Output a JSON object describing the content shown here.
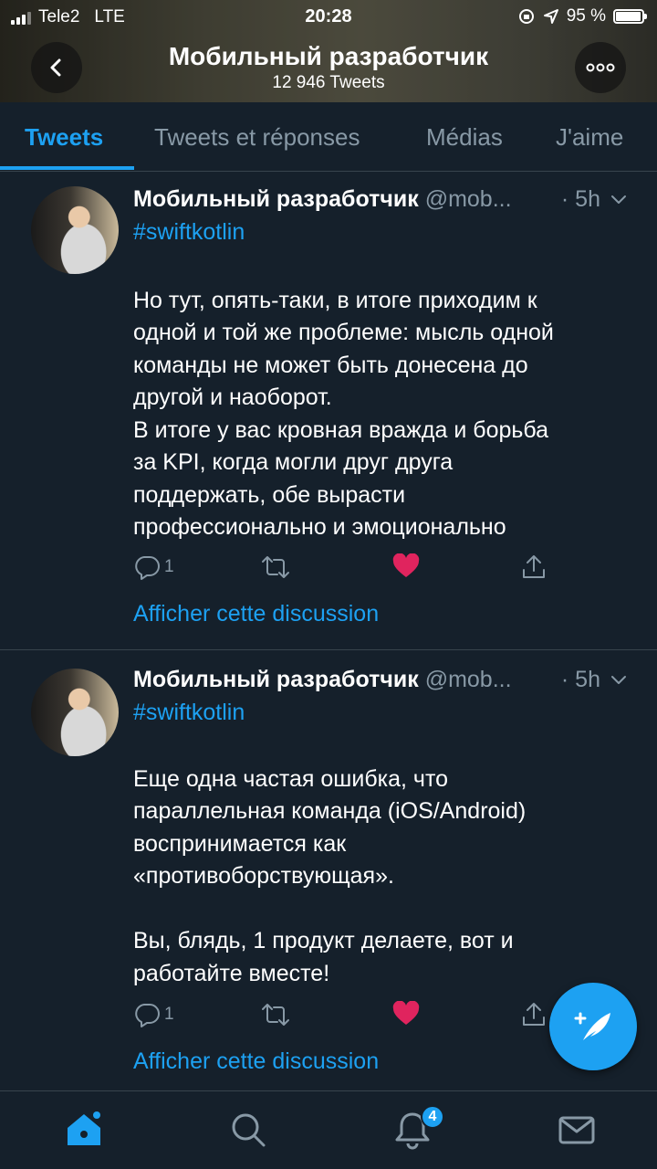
{
  "status_bar": {
    "carrier": "Tele2",
    "network": "LTE",
    "time": "20:28",
    "battery": "95 %"
  },
  "header": {
    "title": "Мобильный разработчик",
    "tweet_count": "12 946 Tweets"
  },
  "tabs": [
    {
      "label": "Tweets",
      "active": true
    },
    {
      "label": "Tweets et réponses",
      "active": false
    },
    {
      "label": "Médias",
      "active": false
    },
    {
      "label": "J'aime",
      "active": false
    }
  ],
  "tweets": [
    {
      "name": "Мобильный разработчик",
      "handle": "@mob...",
      "time": "· 5h",
      "hashtag": "#swiftkotlin",
      "lines": [
        "",
        "Но тут, опять-таки, в итоге приходим к",
        "одной и той же проблеме: мысль одной",
        "команды не может быть донесена до",
        "другой и наоборот.",
        "В итоге у вас кровная вражда и борьба",
        "за KPI, когда могли друг друга",
        "поддержать, обе вырасти",
        "профессионально и эмоционально"
      ],
      "reply_count": "1",
      "thread_link": "Afficher cette discussion"
    },
    {
      "name": "Мобильный разработчик",
      "handle": "@mob...",
      "time": "· 5h",
      "hashtag": "#swiftkotlin",
      "lines": [
        "",
        "Еще одна частая ошибка, что",
        "параллельная команда (iOS/Android)",
        "воспринимается как",
        "«противоборствующая».",
        "",
        "Вы, блядь, 1 продукт делаете, вот и",
        "работайте вместе!"
      ],
      "reply_count": "1",
      "thread_link": "Afficher cette discussion"
    }
  ],
  "bottom_nav": {
    "notifications_badge": "4"
  },
  "colors": {
    "background": "#15202b",
    "accent": "#1da1f2",
    "like": "#e0245e",
    "muted": "#8899a6"
  }
}
